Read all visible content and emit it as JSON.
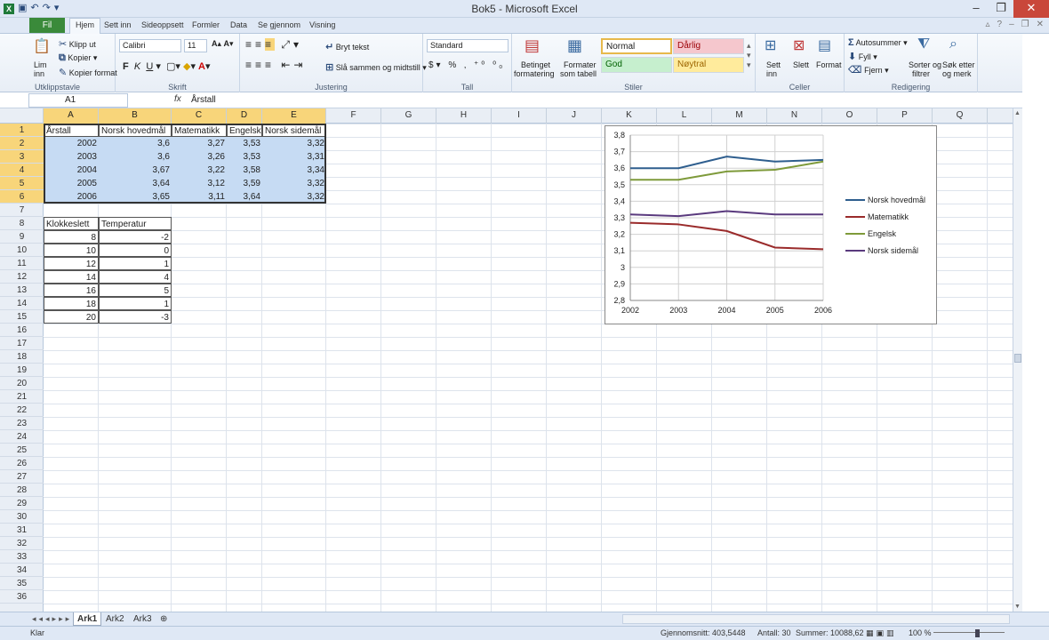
{
  "window": {
    "title": "Bok5 - Microsoft Excel"
  },
  "tabs": {
    "file": "Fil",
    "items": [
      "Hjem",
      "Sett inn",
      "Sideoppsett",
      "Formler",
      "Data",
      "Se gjennom",
      "Visning"
    ]
  },
  "ribbon": {
    "clipboard": {
      "paste": "Lim",
      "paste2": "inn",
      "cut": "Klipp ut",
      "copy": "Kopier",
      "format_painter": "Kopier format",
      "label": "Utklippstavle"
    },
    "font": {
      "name": "Calibri",
      "size": "11",
      "label": "Skrift"
    },
    "alignment": {
      "wrap": "Bryt tekst",
      "merge": "Slå sammen og midtstill",
      "label": "Justering"
    },
    "number": {
      "format": "Standard",
      "label": "Tall"
    },
    "styles": {
      "conditional": "Betinget",
      "conditional2": "formatering",
      "table": "Formater",
      "table2": "som tabell",
      "normal": "Normal",
      "bad": "Dårlig",
      "good": "God",
      "neutral": "Nøytral",
      "label": "Stiler"
    },
    "cells": {
      "insert": "Sett",
      "insert2": "inn",
      "delete": "Slett",
      "format": "Format",
      "label": "Celler"
    },
    "editing": {
      "autosum": "Autosummer",
      "fill": "Fyll",
      "clear": "Fjern",
      "sort": "Sorter og",
      "sort2": "filtrer",
      "find": "Søk etter",
      "find2": "og merk",
      "label": "Redigering"
    }
  },
  "formula": {
    "namebox": "A1",
    "fx": "fx",
    "content": "Årstall"
  },
  "columns": [
    "A",
    "B",
    "C",
    "D",
    "E",
    "F",
    "G",
    "H",
    "I",
    "J",
    "K",
    "L",
    "M",
    "N",
    "O",
    "P",
    "Q"
  ],
  "rows": [
    "1",
    "2",
    "3",
    "4",
    "5",
    "6",
    "7",
    "8",
    "9",
    "10",
    "11",
    "12",
    "13",
    "14",
    "15",
    "16",
    "17",
    "18",
    "19",
    "20",
    "21",
    "22",
    "23",
    "24",
    "25",
    "26",
    "27",
    "28",
    "29",
    "30",
    "31",
    "32",
    "33",
    "34",
    "35",
    "36"
  ],
  "table1": {
    "headers": [
      "Årstall",
      "Norsk hovedmål",
      "Matematikk",
      "Engelsk",
      "Norsk sidemål"
    ],
    "rows": [
      [
        "2002",
        "3,6",
        "3,27",
        "3,53",
        "3,32"
      ],
      [
        "2003",
        "3,6",
        "3,26",
        "3,53",
        "3,31"
      ],
      [
        "2004",
        "3,67",
        "3,22",
        "3,58",
        "3,34"
      ],
      [
        "2005",
        "3,64",
        "3,12",
        "3,59",
        "3,32"
      ],
      [
        "2006",
        "3,65",
        "3,11",
        "3,64",
        "3,32"
      ]
    ]
  },
  "table2": {
    "headers": [
      "Klokkeslett",
      "Temperatur"
    ],
    "rows": [
      [
        "8",
        "-2"
      ],
      [
        "10",
        "0"
      ],
      [
        "12",
        "1"
      ],
      [
        "14",
        "4"
      ],
      [
        "16",
        "5"
      ],
      [
        "18",
        "1"
      ],
      [
        "20",
        "-3"
      ]
    ]
  },
  "chart_data": {
    "type": "line",
    "x": [
      "2002",
      "2003",
      "2004",
      "2005",
      "2006"
    ],
    "series": [
      {
        "name": "Norsk hovedmål",
        "values": [
          3.6,
          3.6,
          3.67,
          3.64,
          3.65
        ],
        "color": "#2e5e8e"
      },
      {
        "name": "Matematikk",
        "values": [
          3.27,
          3.26,
          3.22,
          3.12,
          3.11
        ],
        "color": "#9a2b2b"
      },
      {
        "name": "Engelsk",
        "values": [
          3.53,
          3.53,
          3.58,
          3.59,
          3.64
        ],
        "color": "#7e9a3a"
      },
      {
        "name": "Norsk sidemål",
        "values": [
          3.32,
          3.31,
          3.34,
          3.32,
          3.32
        ],
        "color": "#5a3a7e"
      }
    ],
    "ylim": [
      2.8,
      3.8
    ],
    "yticks": [
      "2,8",
      "2,9",
      "3",
      "3,1",
      "3,2",
      "3,3",
      "3,4",
      "3,5",
      "3,6",
      "3,7",
      "3,8"
    ],
    "legend": "right",
    "grid": true
  },
  "sheets": [
    "Ark1",
    "Ark2",
    "Ark3"
  ],
  "status": {
    "ready": "Klar",
    "average": "Gjennomsnitt: 403,5448",
    "count": "Antall: 30",
    "sum": "Summer: 10088,62",
    "zoom": "100 %"
  }
}
